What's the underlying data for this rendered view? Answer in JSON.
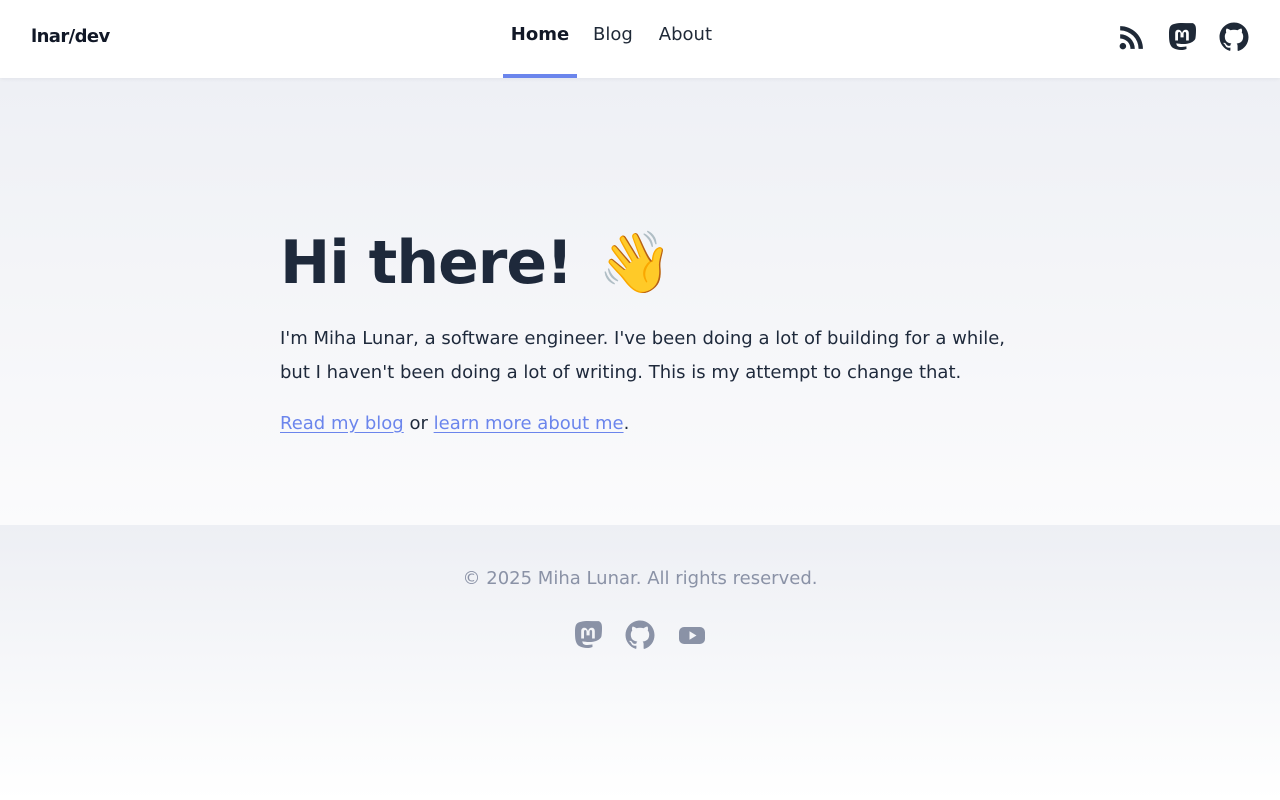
{
  "header": {
    "logo": "lnar/dev",
    "nav": [
      {
        "label": "Home",
        "active": true
      },
      {
        "label": "Blog",
        "active": false
      },
      {
        "label": "About",
        "active": false
      }
    ],
    "icons": [
      "rss-icon",
      "mastodon-icon",
      "github-icon"
    ]
  },
  "hero": {
    "title": "Hi there!",
    "emoji": "👋",
    "intro": "I'm Miha Lunar, a software engineer. I've been doing a lot of building for a while, but I haven't been doing a lot of writing. This is my attempt to change that.",
    "link_blog": "Read my blog",
    "connector": "or",
    "link_about": "learn more about me",
    "trailing": "."
  },
  "footer": {
    "copyright": "© 2025 Miha Lunar. All rights reserved.",
    "icons": [
      "mastodon-icon",
      "github-icon",
      "youtube-icon"
    ]
  },
  "colors": {
    "accent": "#6b85ec",
    "text": "#1e293b",
    "muted": "#8a92a6",
    "footer_icon": "#8a92a6"
  }
}
